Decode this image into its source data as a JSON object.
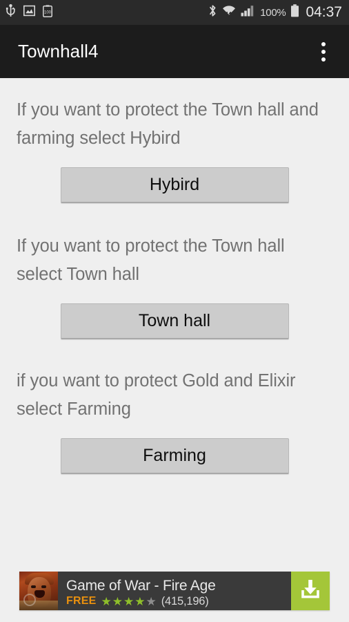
{
  "status_bar": {
    "left_icons": [
      {
        "name": "usb-icon",
        "label": "USB"
      },
      {
        "name": "screenshot-image-icon",
        "label": "Screenshot"
      },
      {
        "name": "battery-100-clipboard-icon",
        "label": "100"
      }
    ],
    "right_icons": [
      {
        "name": "bluetooth-icon",
        "label": "Bluetooth"
      },
      {
        "name": "wifi-icon",
        "label": "Wi-Fi"
      },
      {
        "name": "cellular-signal-icon",
        "label": "Signal"
      }
    ],
    "battery_percent": "100%",
    "battery_icon": "battery-full-icon",
    "clock": "04:37",
    "background_color": "#2a2a2a"
  },
  "app_bar": {
    "title": "Townhall4",
    "overflow_icon": "overflow-menu-icon",
    "background_color": "#1c1c1c",
    "title_color": "#ffffff"
  },
  "content": {
    "background_color": "#efefef",
    "text_color": "#727272",
    "sections": [
      {
        "description": "If you want to protect the Town hall and farming select Hybird",
        "button_label": "Hybird"
      },
      {
        "description": "If you want to protect the Town hall select Town hall",
        "button_label": "Town hall"
      },
      {
        "description": "if you want to protect Gold and Elixir select Farming",
        "button_label": "Farming"
      }
    ],
    "button_color": "#cccccc",
    "button_text_color": "#0d0d0d"
  },
  "ad": {
    "icon_name": "game-of-war-app-icon",
    "title": "Game of War - Fire Age",
    "price": "FREE",
    "rating": 4,
    "rating_max": 5,
    "rating_count": "(415,196)",
    "cta_icon": "download-icon",
    "cta_color": "#a4c639",
    "price_color": "#e8900f",
    "star_color": "#8fbf2a",
    "background_color": "#3a3a3a"
  }
}
